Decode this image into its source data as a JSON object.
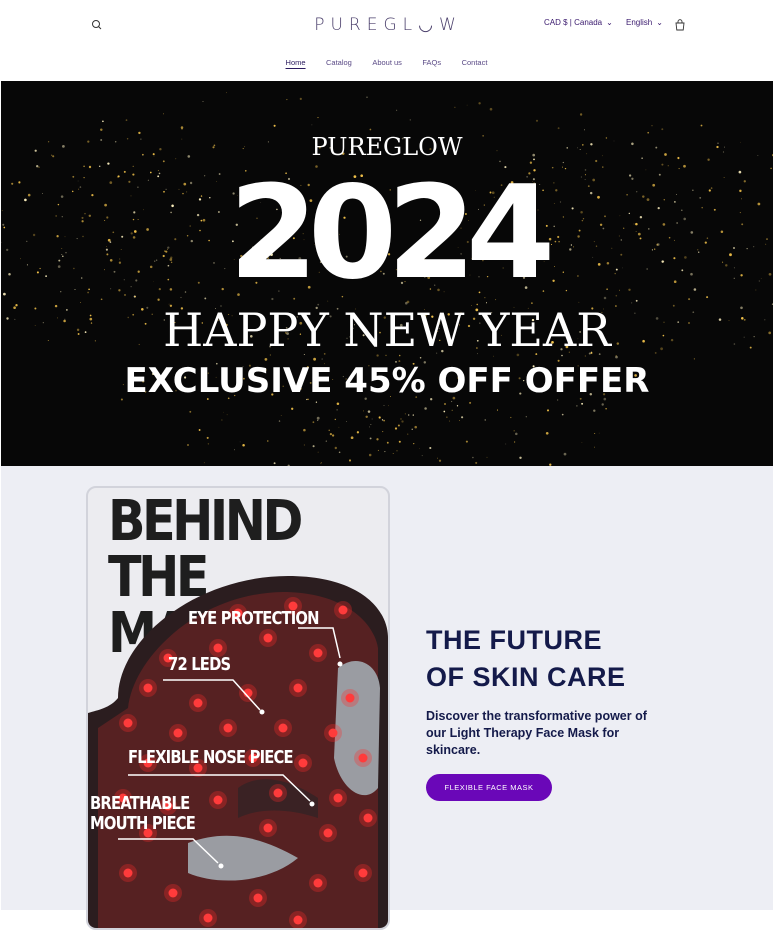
{
  "header": {
    "logo": "PUREGL◡W",
    "currency": "CAD $ | Canada",
    "language": "English",
    "nav": [
      "Home",
      "Catalog",
      "About us",
      "FAQs",
      "Contact"
    ]
  },
  "hero": {
    "brand": "PUREGLOW",
    "year": "2024",
    "greeting": "HAPPY NEW YEAR",
    "offer": "EXCLUSIVE 45% OFF OFFER"
  },
  "feature": {
    "card_title_line1": "BEHIND THE",
    "card_title_line2": "MASK",
    "callouts": {
      "eye": "EYE PROTECTION",
      "leds": "72 LEDS",
      "nose": "FLEXIBLE NOSE PIECE",
      "mouth1": "BREATHABLE",
      "mouth2": "MOUTH PIECE"
    },
    "title_line1": "THE FUTURE",
    "title_line2": "OF SKIN CARE",
    "description": "Discover the transformative power of our Light Therapy Face Mask for skincare.",
    "button": "FLEXIBLE FACE MASK"
  },
  "colors": {
    "accent": "#6a07b8",
    "heading": "#141a4a",
    "section_bg": "#edeef4",
    "led_red": "#ff2a2a"
  }
}
